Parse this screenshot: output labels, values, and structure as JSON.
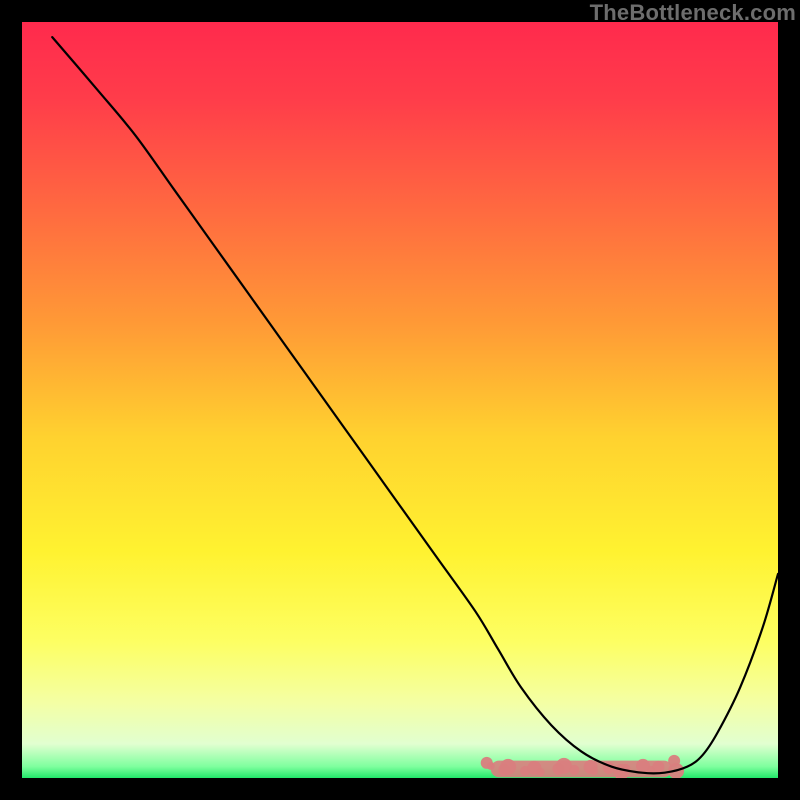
{
  "watermark": "TheBottleneck.com",
  "chart_data": {
    "type": "line",
    "title": "",
    "xlabel": "",
    "ylabel": "",
    "xlim": [
      0,
      100
    ],
    "ylim": [
      0,
      100
    ],
    "grid": false,
    "series": [
      {
        "name": "curve",
        "color": "#000000",
        "x": [
          4,
          10,
          15,
          20,
          25,
          30,
          35,
          40,
          45,
          50,
          55,
          60,
          63,
          66,
          70,
          74,
          78,
          82,
          85,
          88,
          90,
          92,
          95,
          98,
          100
        ],
        "y": [
          98,
          91,
          85,
          78,
          71,
          64,
          57,
          50,
          43,
          36,
          29,
          22,
          17,
          12,
          7,
          3.5,
          1.5,
          0.7,
          0.7,
          1.5,
          3,
          6,
          12,
          20,
          27
        ]
      }
    ],
    "marker_band": {
      "color": "#d97e7e",
      "shape": "rounded-rect",
      "x_range": [
        62,
        86
      ],
      "y": 1.2,
      "height": 2.2
    },
    "gradient": {
      "type": "vertical",
      "stops": [
        {
          "offset": 0.0,
          "color": "#ff2a4d"
        },
        {
          "offset": 0.1,
          "color": "#ff3c4a"
        },
        {
          "offset": 0.25,
          "color": "#ff6a40"
        },
        {
          "offset": 0.4,
          "color": "#ff9a36"
        },
        {
          "offset": 0.55,
          "color": "#ffd22f"
        },
        {
          "offset": 0.7,
          "color": "#fff230"
        },
        {
          "offset": 0.82,
          "color": "#fdff63"
        },
        {
          "offset": 0.9,
          "color": "#f4ffa4"
        },
        {
          "offset": 0.955,
          "color": "#e1ffd0"
        },
        {
          "offset": 0.985,
          "color": "#7eff9e"
        },
        {
          "offset": 1.0,
          "color": "#22e66a"
        }
      ]
    }
  }
}
